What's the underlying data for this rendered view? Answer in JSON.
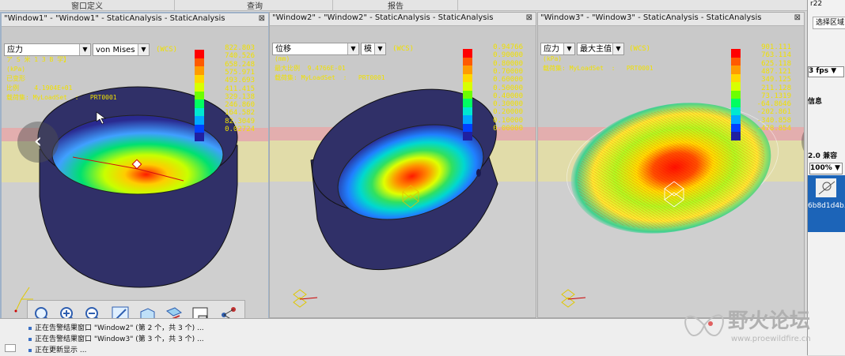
{
  "menu": {
    "items": [
      "窗口定义",
      "查询",
      "报告"
    ]
  },
  "windows": [
    {
      "title": "\"Window1\" - \"Window1\" - StaticAnalysis - StaticAnalysis",
      "dropdown1": "应力",
      "dropdown2": "von Mises",
      "wcs": "(WCS)",
      "info_lines": [
        "ア S 米 1 3 B 学】",
        "(kPa)",
        "已变形",
        "比例    4.1904E+01",
        "载荷集: MyLoadSet  :   PRT0001"
      ],
      "legend": [
        "822.803",
        "740.526",
        "658.248",
        "575.971",
        "493.693",
        "411.415",
        "329.138",
        "246.860",
        "164.582",
        "82.3049",
        "0.02724"
      ],
      "legend_colors": [
        "#ff0000",
        "#ff5a00",
        "#ff9c00",
        "#ffd800",
        "#d8ff00",
        "#6cff00",
        "#00ff60",
        "#00e8d0",
        "#00a8ff",
        "#0040ff",
        "#2020a0"
      ]
    },
    {
      "title": "\"Window2\" - \"Window2\" - StaticAnalysis - StaticAnalysis",
      "dropdown1": "位移",
      "dropdown2": "模",
      "wcs": "(WCS)",
      "info_lines": [
        "(mm)",
        "最大比例  9.4766E-01",
        "载荷集: MyLoadSet  :   PRT0001"
      ],
      "legend": [
        "0.94766",
        "0.90000",
        "0.80000",
        "0.70000",
        "0.60000",
        "0.50000",
        "0.40000",
        "0.30000",
        "0.20000",
        "0.10000",
        "0.00000"
      ],
      "legend_colors": [
        "#ff0000",
        "#ff5a00",
        "#ff9c00",
        "#ffd800",
        "#d8ff00",
        "#6cff00",
        "#00ff60",
        "#00e8d0",
        "#00a8ff",
        "#0040ff",
        "#2020a0"
      ]
    },
    {
      "title": "\"Window3\" - \"Window3\" - StaticAnalysis - StaticAnalysis",
      "dropdown1": "应力",
      "dropdown2": "最大主值",
      "wcs": "(WCS)",
      "info_lines": [
        "(kPa)",
        "载荷集: MyLoadSet  :   PRT0001"
      ],
      "legend": [
        "901.111",
        "763.114",
        "625.118",
        "487.121",
        "349.125",
        "211.128",
        "73.1319",
        "-64.8646",
        "-202.861",
        "-340.858",
        "-478.854"
      ],
      "legend_colors": [
        "#ff0000",
        "#ff5a00",
        "#ff9c00",
        "#ffd800",
        "#d8ff00",
        "#6cff00",
        "#00ff60",
        "#00e8d0",
        "#00a8ff",
        "#0040ff",
        "#2020a0"
      ]
    }
  ],
  "nav": {
    "prev": "‹",
    "next": "›"
  },
  "right_panel": {
    "top_text": "r22",
    "button": "选择区域",
    "fps": "3 fps ▼",
    "info": "信息",
    "compat": "2.0 兼容",
    "zoom": "100% ▼",
    "hash": "6b8d1d4b."
  },
  "status": [
    "正在告警结果窗口 \"Window2\" (第 2 个，共 3 个) ...",
    "正在告警结果窗口 \"Window3\" (第 3 个，共 3 个) ...",
    "正在更新显示 ..."
  ],
  "watermark": {
    "text": "野火论坛",
    "url": "www.proewildfire.cn"
  }
}
